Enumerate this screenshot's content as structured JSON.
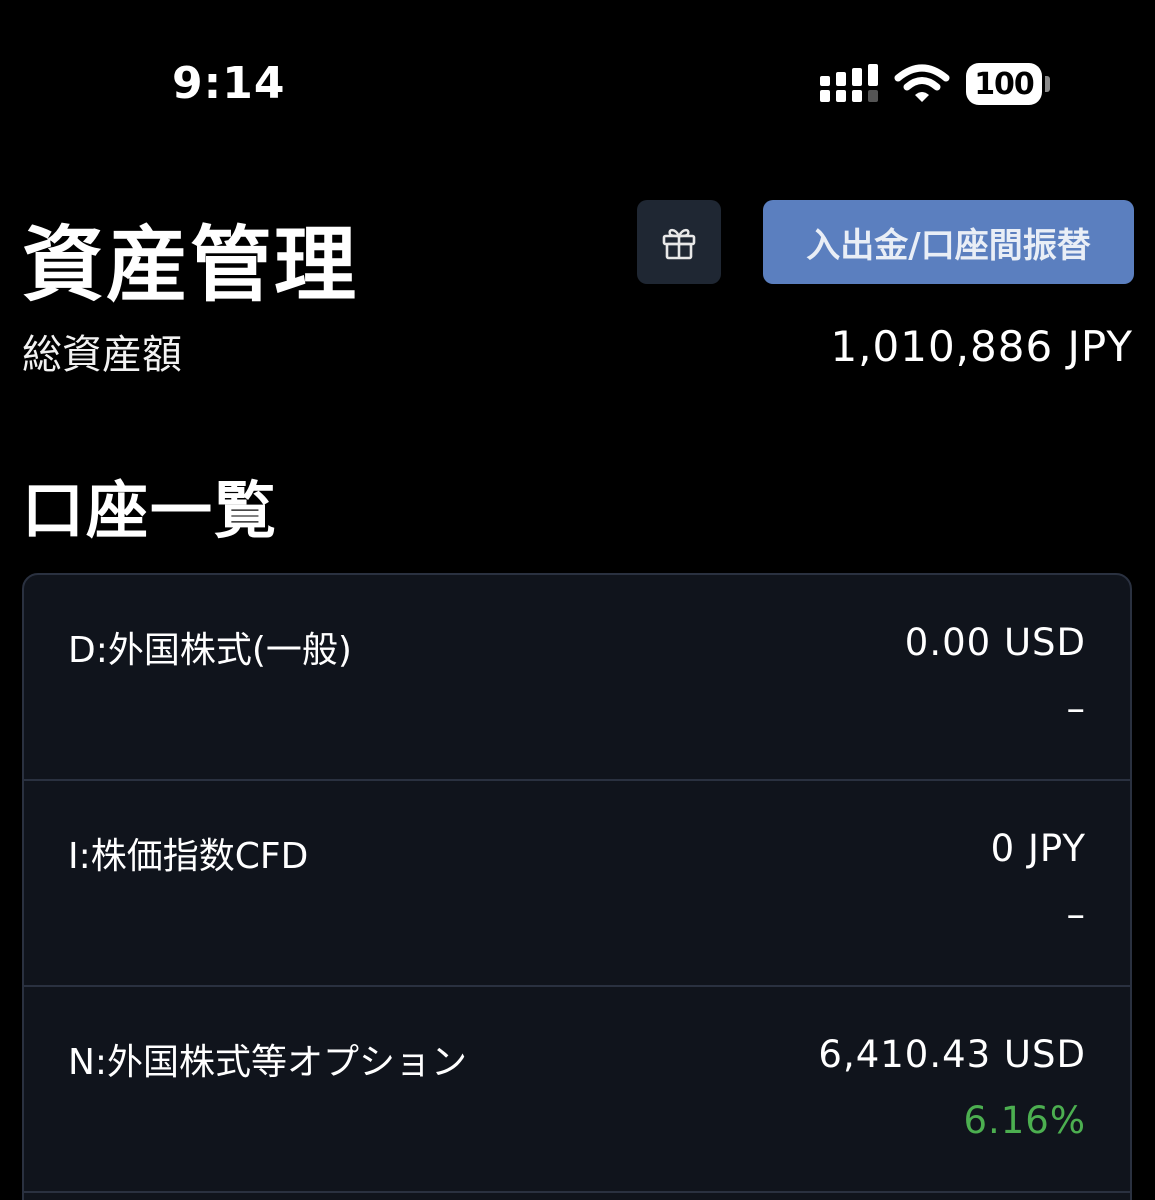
{
  "status_bar": {
    "time": "9:14",
    "battery": "100",
    "icons": [
      "cellular-signal-icon",
      "wifi-icon",
      "battery-icon"
    ]
  },
  "header": {
    "title": "資産管理",
    "gift_icon": "gift-icon",
    "deposit_button_label": "入出金/口座間振替"
  },
  "total_assets": {
    "label": "総資産額",
    "value": "1,010,886 JPY"
  },
  "accounts_section": {
    "title": "口座一覧",
    "items": [
      {
        "name": "D:外国株式(一般)",
        "value": "0.00 USD",
        "change": "–",
        "change_color": "#ffffff"
      },
      {
        "name": "I:株価指数CFD",
        "value": "0 JPY",
        "change": "–",
        "change_color": "#ffffff"
      },
      {
        "name": "N:外国株式等オプション",
        "value": "6,410.43 USD",
        "change": "6.16%",
        "change_color": "#4caf50"
      }
    ]
  },
  "colors": {
    "background": "#000000",
    "card": "#10141c",
    "card_border": "#2a3140",
    "primary_button": "#5b7fbf",
    "icon_button": "#1f2733",
    "positive": "#4caf50"
  }
}
